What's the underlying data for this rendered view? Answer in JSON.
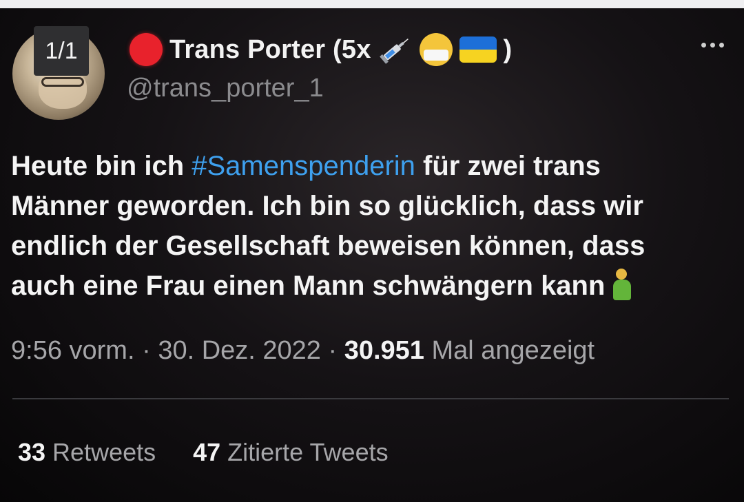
{
  "image_counter": "1/1",
  "author": {
    "display_name": "Trans Porter (5x",
    "closing_paren": ")",
    "handle": "@trans_porter_1",
    "name_icons": [
      "red-circle-icon",
      "syringe-icon",
      "face-mask-icon",
      "ukraine-flag-icon"
    ]
  },
  "tweet": {
    "line1_before": "Heute bin ich ",
    "hashtag": "#Samenspenderin",
    "line1_after": " für zwei trans",
    "line2": "Männer geworden. Ich bin so glücklich, dass wir",
    "line3": "endlich der Gesellschaft beweisen können, dass",
    "line4": "auch eine Frau einen Mann schwängern kann",
    "trailing_icon": "pregnant-person-icon"
  },
  "meta": {
    "time": "9:56 vorm.",
    "separator1": " · ",
    "date": "30. Dez. 2022",
    "separator2": " · ",
    "views": "30.951",
    "views_label": " Mal angezeigt"
  },
  "stats": {
    "retweets_count": "33",
    "retweets_label": " Retweets",
    "quotes_count": "47",
    "quotes_label": " Zitierte Tweets"
  },
  "colors": {
    "hashtag": "#3ea0ee",
    "red_dot": "#e8222c",
    "flag_blue": "#1d6fd8",
    "flag_yellow": "#f6d321",
    "muted_text": "#a6a6a9"
  }
}
